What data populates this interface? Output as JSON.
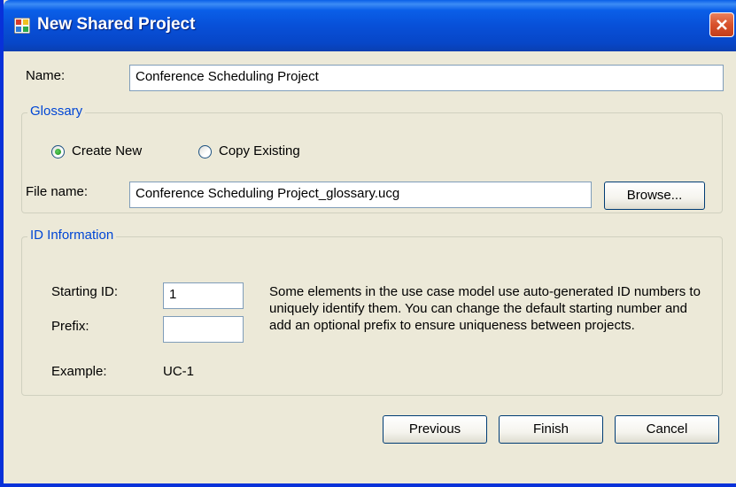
{
  "window": {
    "title": "New Shared Project"
  },
  "name_field": {
    "label": "Name:",
    "value": "Conference Scheduling Project"
  },
  "glossary": {
    "group_title": "Glossary",
    "radio_create_new": "Create New",
    "radio_copy_existing": "Copy Existing",
    "selected": "Create New",
    "file_name_label": "File name:",
    "file_name_value": "Conference Scheduling Project_glossary.ucg",
    "browse_label": "Browse..."
  },
  "id_info": {
    "group_title": "ID Information",
    "starting_id_label": "Starting ID:",
    "starting_id_value": "1",
    "prefix_label": "Prefix:",
    "prefix_value": "",
    "description": "Some elements in the use case model use auto-generated ID numbers to uniquely identify them. You can change the default starting number and add an optional prefix to ensure uniqueness between projects.",
    "example_label": "Example:",
    "example_value": "UC-1"
  },
  "buttons": {
    "previous": "Previous",
    "finish": "Finish",
    "cancel": "Cancel"
  },
  "colors": {
    "titlebar": "#0a5fe8",
    "group_title": "#0046d5",
    "dialog_bg": "#ece9d8",
    "close_button": "#d8512b"
  }
}
